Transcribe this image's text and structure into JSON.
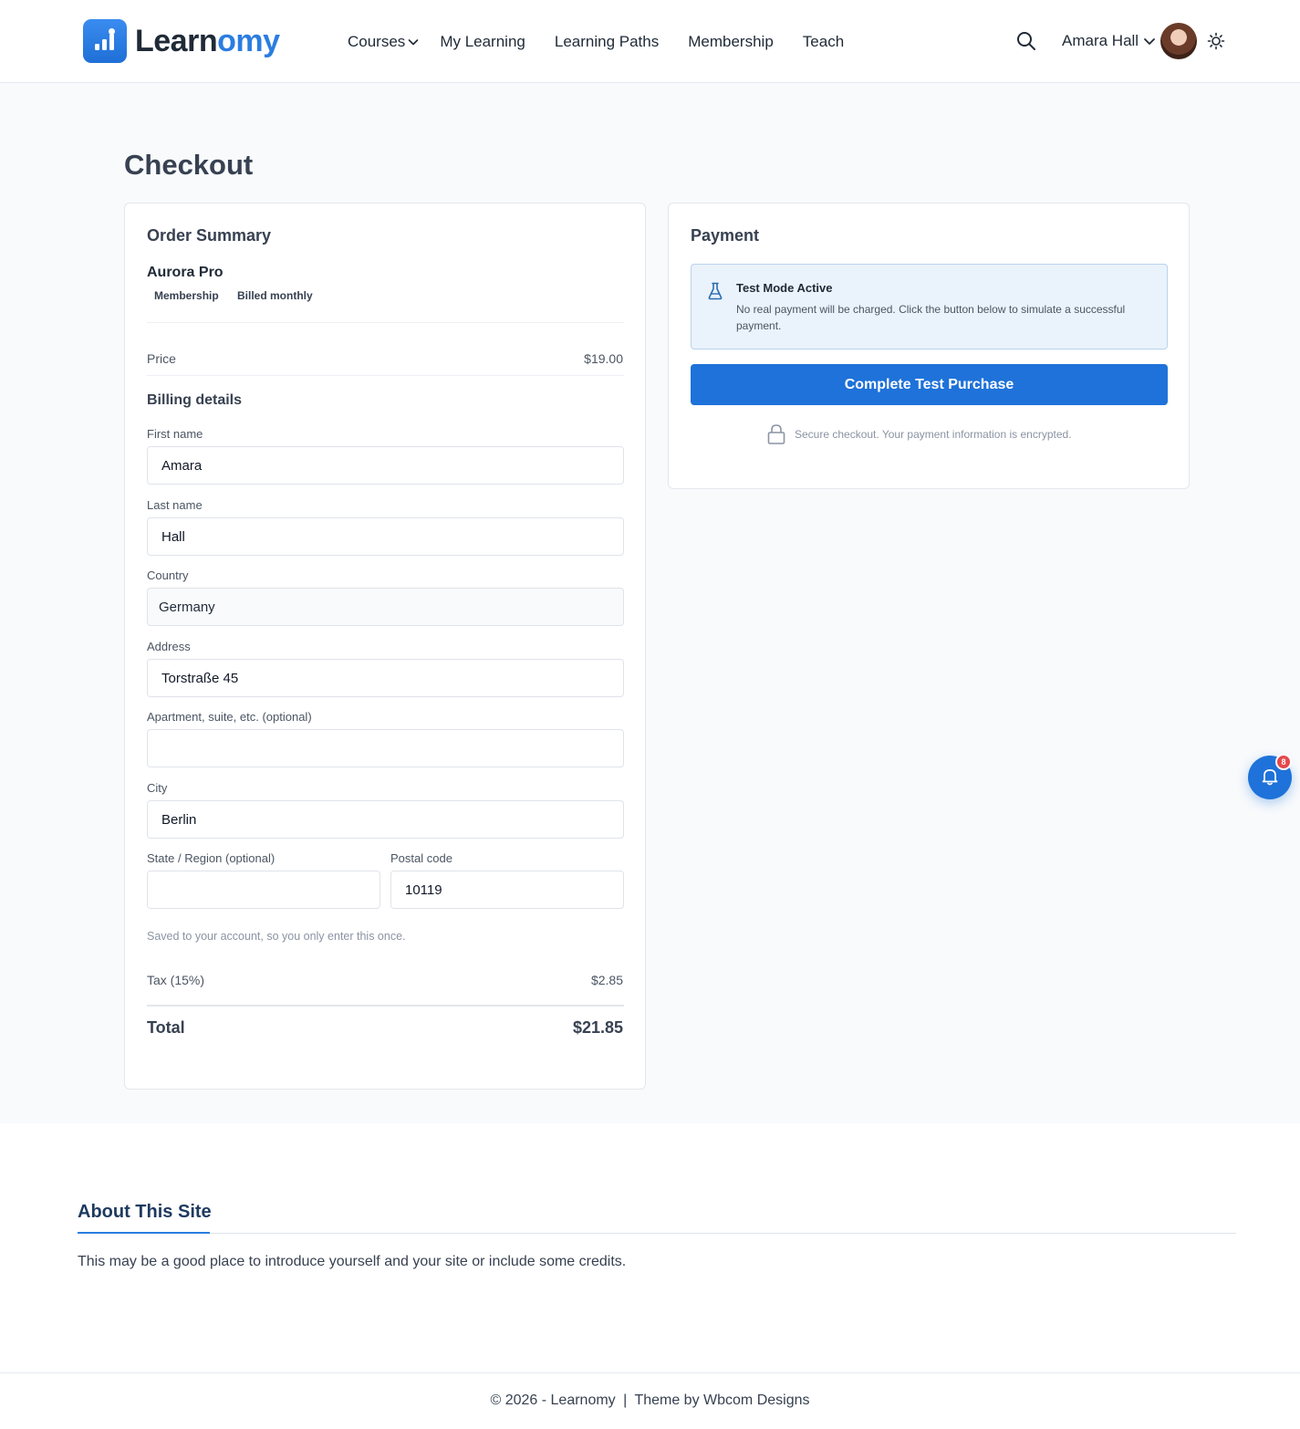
{
  "brand": {
    "name_part1": "Learn",
    "name_part2": "omy",
    "accent_color": "#2b7de0"
  },
  "nav": {
    "items": [
      {
        "label": "Courses",
        "has_dropdown": true
      },
      {
        "label": "My Learning"
      },
      {
        "label": "Learning Paths"
      },
      {
        "label": "Membership"
      },
      {
        "label": "Teach"
      }
    ]
  },
  "header": {
    "search_icon": "search-icon",
    "user_name": "Amara Hall",
    "theme_icon": "sun-icon"
  },
  "page": {
    "title": "Checkout"
  },
  "order_summary": {
    "title": "Order Summary",
    "product_name": "Aurora Pro",
    "tags": [
      "Membership",
      "Billed monthly"
    ],
    "price_label": "Price",
    "price_value": "$19.00",
    "billing_title": "Billing details",
    "fields": {
      "first_name": {
        "label": "First name",
        "value": "Amara"
      },
      "last_name": {
        "label": "Last name",
        "value": "Hall"
      },
      "country": {
        "label": "Country",
        "value": "Germany"
      },
      "address": {
        "label": "Address",
        "value": "Torstraße 45"
      },
      "apartment": {
        "label": "Apartment, suite, etc. (optional)",
        "value": ""
      },
      "city": {
        "label": "City",
        "value": "Berlin"
      },
      "state": {
        "label": "State / Region (optional)",
        "value": ""
      },
      "postal": {
        "label": "Postal code",
        "value": "10119"
      }
    },
    "helper_text": "Saved to your account, so you only enter this once.",
    "tax_label": "Tax (15%)",
    "tax_value": "$2.85",
    "total_label": "Total",
    "total_value": "$21.85"
  },
  "payment": {
    "title": "Payment",
    "notice_title": "Test Mode Active",
    "notice_text": "No real payment will be charged. Click the button below to simulate a successful payment.",
    "button_label": "Complete Test Purchase",
    "secure_text": "Secure checkout. Your payment information is encrypted.",
    "button_color": "#1e72d9"
  },
  "notifications": {
    "count": "8",
    "icon": "bell-icon"
  },
  "about": {
    "title": "About This Site",
    "text": "This may be a good place to introduce yourself and your site or include some credits."
  },
  "footer": {
    "copyright": "© 2026 - Learnomy",
    "separator": "|",
    "theme_by": "Theme by",
    "theme_author": "Wbcom Designs"
  }
}
